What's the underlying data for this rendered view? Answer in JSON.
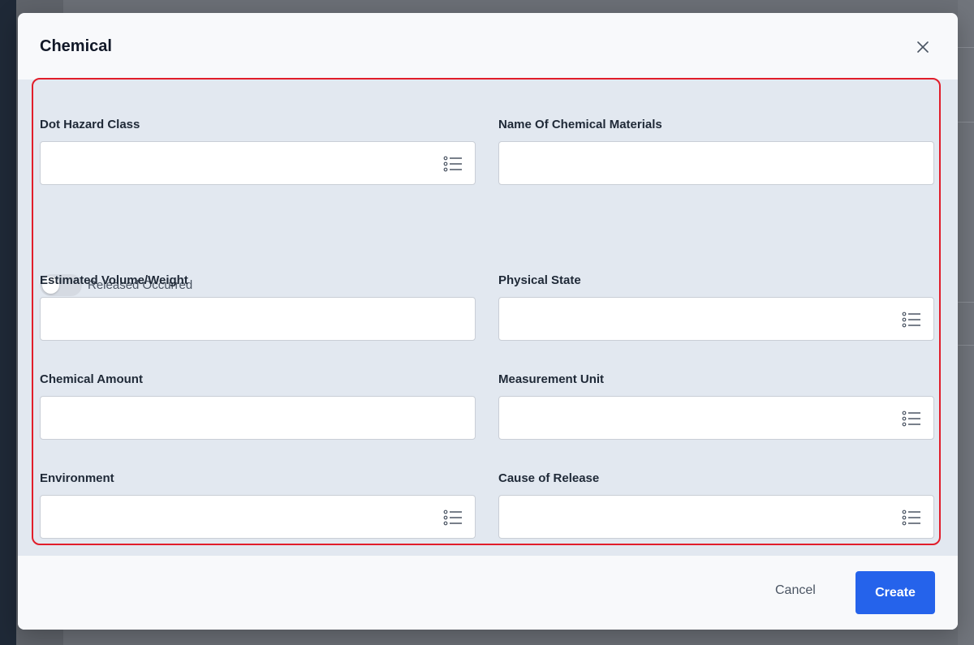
{
  "modal": {
    "title": "Chemical",
    "close_icon": "close-icon"
  },
  "fields": {
    "dot_hazard_class": {
      "label": "Dot Hazard Class",
      "value": "",
      "icon": "list-icon"
    },
    "name_of_chemical_materials": {
      "label": "Name Of Chemical Materials",
      "value": ""
    },
    "released_occurred": {
      "label": "Released Occurred",
      "checked": false
    },
    "estimated_volume_weight": {
      "label": "Estimated Volume/Weight",
      "value": ""
    },
    "physical_state": {
      "label": "Physical State",
      "value": "",
      "icon": "list-icon"
    },
    "chemical_amount": {
      "label": "Chemical Amount",
      "value": ""
    },
    "measurement_unit": {
      "label": "Measurement Unit",
      "value": "",
      "icon": "list-icon"
    },
    "environment": {
      "label": "Environment",
      "value": "",
      "icon": "list-icon"
    },
    "cause_of_release": {
      "label": "Cause of Release",
      "value": "",
      "icon": "list-icon"
    }
  },
  "footer": {
    "cancel_label": "Cancel",
    "create_label": "Create"
  },
  "colors": {
    "accent": "#2563eb",
    "highlight_border": "#e11d2a",
    "body_bg": "#e2e8f0"
  }
}
